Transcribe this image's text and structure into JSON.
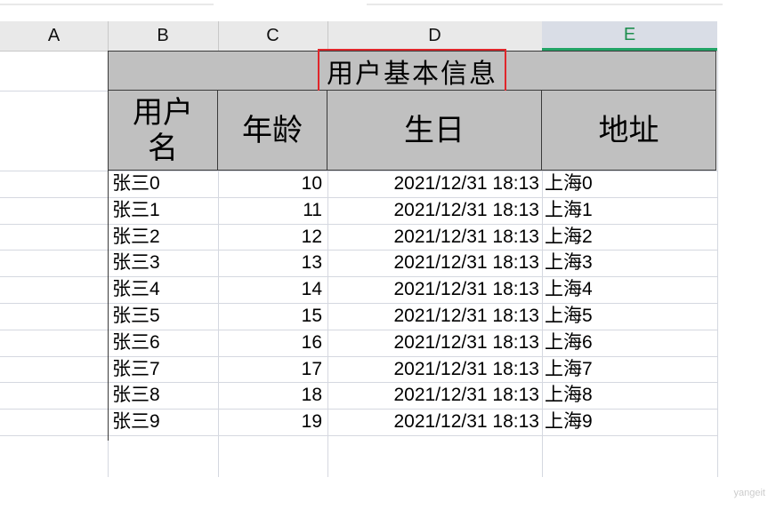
{
  "columns": [
    "A",
    "B",
    "C",
    "D",
    "E"
  ],
  "active_column": "E",
  "title": "用户基本信息",
  "headers": {
    "name": "用户名",
    "name_line1": "用户",
    "name_line2": "名",
    "age": "年龄",
    "birthday": "生日",
    "address": "地址"
  },
  "rows": [
    {
      "name": "张三0",
      "age": "10",
      "birthday": "2021/12/31 18:13",
      "address": "上海0"
    },
    {
      "name": "张三1",
      "age": "11",
      "birthday": "2021/12/31 18:13",
      "address": "上海1"
    },
    {
      "name": "张三2",
      "age": "12",
      "birthday": "2021/12/31 18:13",
      "address": "上海2"
    },
    {
      "name": "张三3",
      "age": "13",
      "birthday": "2021/12/31 18:13",
      "address": "上海3"
    },
    {
      "name": "张三4",
      "age": "14",
      "birthday": "2021/12/31 18:13",
      "address": "上海4"
    },
    {
      "name": "张三5",
      "age": "15",
      "birthday": "2021/12/31 18:13",
      "address": "上海5"
    },
    {
      "name": "张三6",
      "age": "16",
      "birthday": "2021/12/31 18:13",
      "address": "上海6"
    },
    {
      "name": "张三7",
      "age": "17",
      "birthday": "2021/12/31 18:13",
      "address": "上海7"
    },
    {
      "name": "张三8",
      "age": "18",
      "birthday": "2021/12/31 18:13",
      "address": "上海8"
    },
    {
      "name": "张三9",
      "age": "19",
      "birthday": "2021/12/31 18:13",
      "address": "上海9"
    }
  ],
  "watermark": "yangeit",
  "colors": {
    "header_fill": "#c0c0c0",
    "highlight_box": "#e0262b",
    "active_column_text": "#1e8e4f",
    "active_column_underline": "#21a366"
  }
}
